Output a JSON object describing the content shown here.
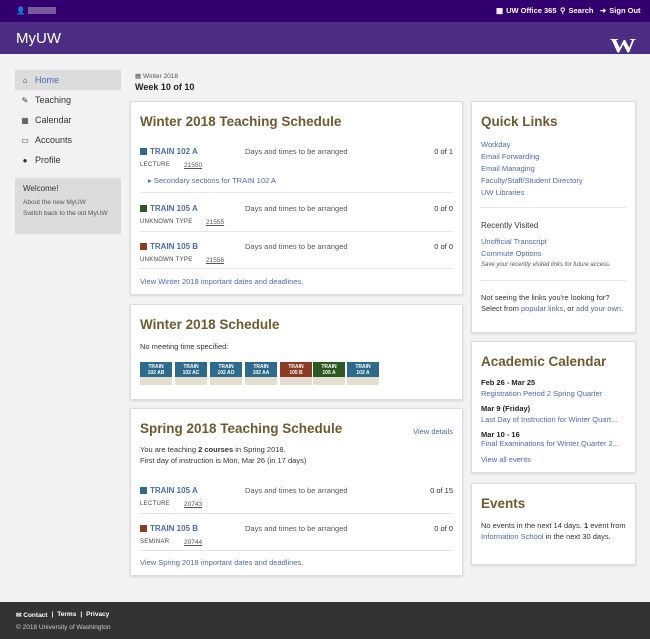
{
  "topbar": {
    "user_name": "",
    "office365": "UW Office 365",
    "search": "Search",
    "signout": "Sign Out"
  },
  "header": {
    "brand": "MyUW",
    "logo": "W"
  },
  "nav": [
    {
      "label": "Home",
      "icon": "home-icon"
    },
    {
      "label": "Teaching",
      "icon": "edit-icon"
    },
    {
      "label": "Calendar",
      "icon": "calendar-icon"
    },
    {
      "label": "Accounts",
      "icon": "credit-card-icon"
    },
    {
      "label": "Profile",
      "icon": "user-icon"
    }
  ],
  "welcome": {
    "title": "Welcome!",
    "about": "About the new MyUW",
    "switch": "Switch back to the old MyUW"
  },
  "term": {
    "label": "Winter 2018",
    "week": "Week 10 of 10"
  },
  "w_teach": {
    "title": "Winter 2018 Teaching Schedule",
    "days": "Days and times to be arranged",
    "courses": [
      {
        "name": "TRAIN 102 A",
        "color": "#2e6a8c",
        "type": "LECTURE",
        "sln": "21550",
        "enroll": "0 of 1"
      },
      {
        "name": "TRAIN 105 A",
        "color": "#2d5a23",
        "type": "UNKNOWN TYPE",
        "sln": "21555",
        "enroll": "0 of 0"
      },
      {
        "name": "TRAIN 105 B",
        "color": "#8a3c24",
        "type": "UNKNOWN TYPE",
        "sln": "21556",
        "enroll": "0 of 0"
      }
    ],
    "secondary": "Secondary sections for TRAIN 102 A",
    "dates_link": "View Winter 2018 important dates and deadlines."
  },
  "w_sched": {
    "title": "Winter 2018 Schedule",
    "note": "No meeting time specified:",
    "blocks": [
      {
        "l1": "TRAIN",
        "l2": "102 AB",
        "color": "#2e6a8c"
      },
      {
        "l1": "TRAIN",
        "l2": "102 AC",
        "color": "#2e6a8c"
      },
      {
        "l1": "TRAIN",
        "l2": "102 AO",
        "color": "#2e6a8c"
      },
      {
        "l1": "TRAIN",
        "l2": "102 AA",
        "color": "#2e6a8c"
      },
      {
        "l1": "TRAIN",
        "l2": "105 B",
        "color": "#8a3c24"
      },
      {
        "l1": "TRAIN",
        "l2": "105 A",
        "color": "#2d5a23"
      },
      {
        "l1": "TRAIN",
        "l2": "102 A",
        "color": "#2e6a8c"
      }
    ]
  },
  "s_teach": {
    "title": "Spring 2018 Teaching Schedule",
    "view_details": "View details",
    "line1_a": "You are teaching ",
    "line1_b": "2 courses",
    "line1_c": " in Spring 2018.",
    "line2": "First day of instruction is Mon, Mar 26 (in 17 days)",
    "days": "Days and times to be arranged",
    "courses": [
      {
        "name": "TRAIN 105 A",
        "color": "#2e6a8c",
        "type": "LECTURE",
        "sln": "20743",
        "enroll": "0 of 15"
      },
      {
        "name": "TRAIN 105 B",
        "color": "#8a3c24",
        "type": "SEMINAR",
        "sln": "20744",
        "enroll": "0 of 0"
      }
    ],
    "dates_link": "View Spring 2018 important dates and deadlines."
  },
  "quick": {
    "title": "Quick Links",
    "links": [
      "Workday",
      "Email Forwarding",
      "Email Managing",
      "Faculty/Staff/Student Directory",
      "UW Libraries"
    ],
    "recent_title": "Recently Visited",
    "recent": [
      "Unofficial Transcript",
      "Commute Options"
    ],
    "save_note": "Save your recently visited links for future access.",
    "not_seeing_1": "Not seeing the links you're looking for?",
    "select_from": "Select from ",
    "popular": "popular links",
    "or": ", or ",
    "add_own": "add your own",
    "dot": "."
  },
  "acad": {
    "title": "Academic Calendar",
    "events": [
      {
        "date": "Feb 26 - Mar 25",
        "name": "Registration Period 2 Spring Quarter"
      },
      {
        "date": "Mar 9 (Friday)",
        "name": "Last Day of Instruction for Winter Quart..."
      },
      {
        "date": "Mar 10 - 16",
        "name": "Final Examinations for Winter Quarter 2..."
      }
    ],
    "view_all": "View all events"
  },
  "events": {
    "title": "Events",
    "t1": "No events in the next 14 days. ",
    "t2": "1",
    "t3": " event from ",
    "link": "Information School",
    "t4": " in the next 30 days."
  },
  "footer": {
    "contact": "Contact",
    "terms": "Terms",
    "privacy": "Privacy",
    "sep": "|",
    "copy": "© 2018 University of Washington"
  }
}
